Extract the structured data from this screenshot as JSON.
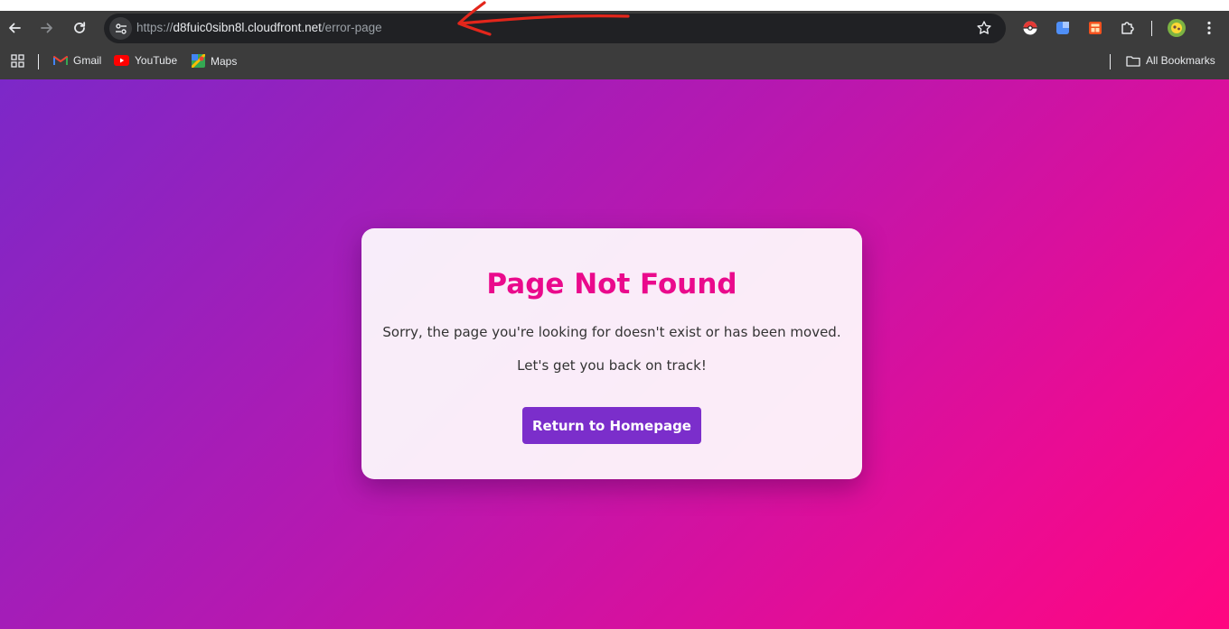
{
  "browser": {
    "url": {
      "scheme": "https://",
      "host": "d8fuic0sibn8l.cloudfront.net",
      "path": "/error-page"
    },
    "bookmarks": [
      {
        "label": "Gmail",
        "icon": "gmail-icon"
      },
      {
        "label": "YouTube",
        "icon": "youtube-icon"
      },
      {
        "label": "Maps",
        "icon": "maps-icon"
      }
    ],
    "all_bookmarks_label": "All Bookmarks",
    "colors": {
      "toolbar": "#3c3c3c",
      "omnibox": "#202124"
    }
  },
  "page": {
    "title": "Page Not Found",
    "message": "Sorry, the page you're looking for doesn't exist or has been moved.",
    "submessage": "Let's get you back on track!",
    "button_label": "Return to Homepage",
    "colors": {
      "title": "#ea0a8c",
      "button": "#7b2ecb",
      "gradient_start": "#7c28c8",
      "gradient_end": "#ff0680"
    }
  }
}
